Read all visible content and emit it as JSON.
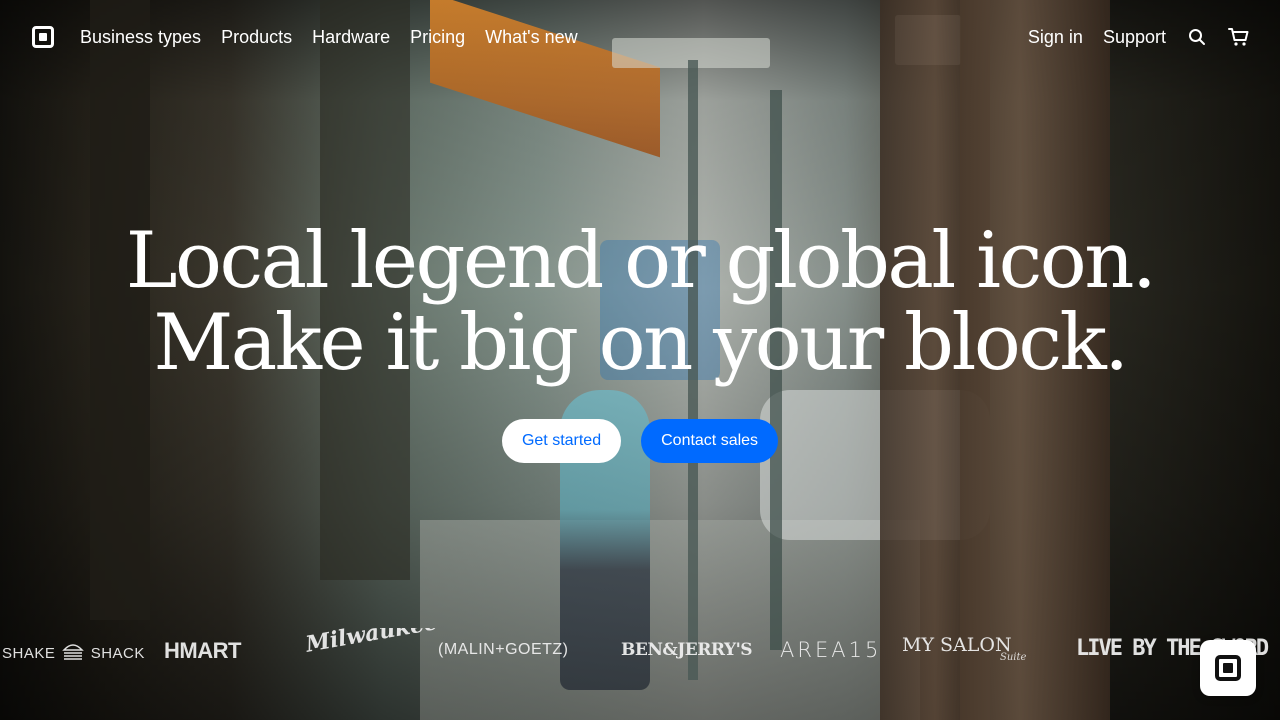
{
  "nav": {
    "links": [
      "Business types",
      "Products",
      "Hardware",
      "Pricing",
      "What's new"
    ],
    "sign_in": "Sign in",
    "support": "Support",
    "icons": {
      "logo": "square-logo-icon",
      "search": "search-icon",
      "cart": "cart-icon"
    }
  },
  "hero": {
    "headline_line1": "Local legend or global icon.",
    "headline_line2": "Make it big on your block.",
    "primary_cta": "Get started",
    "secondary_cta": "Contact sales"
  },
  "brands": {
    "shake_shack_left": "SHAKE",
    "shake_shack_right": "SHACK",
    "hmart": "HMART",
    "milwaukee": "Milwaukee",
    "malin_goetz": "(MALIN+GOETZ)",
    "ben_jerrys": "BEN&JERRY'S",
    "area15": "AREA15",
    "my_salon": "MY SALON",
    "my_salon_suite": "Suite",
    "live_by_the_sword": "LIVE BY THE SWORD"
  },
  "colors": {
    "primary_blue": "#006aff",
    "white": "#ffffff"
  }
}
